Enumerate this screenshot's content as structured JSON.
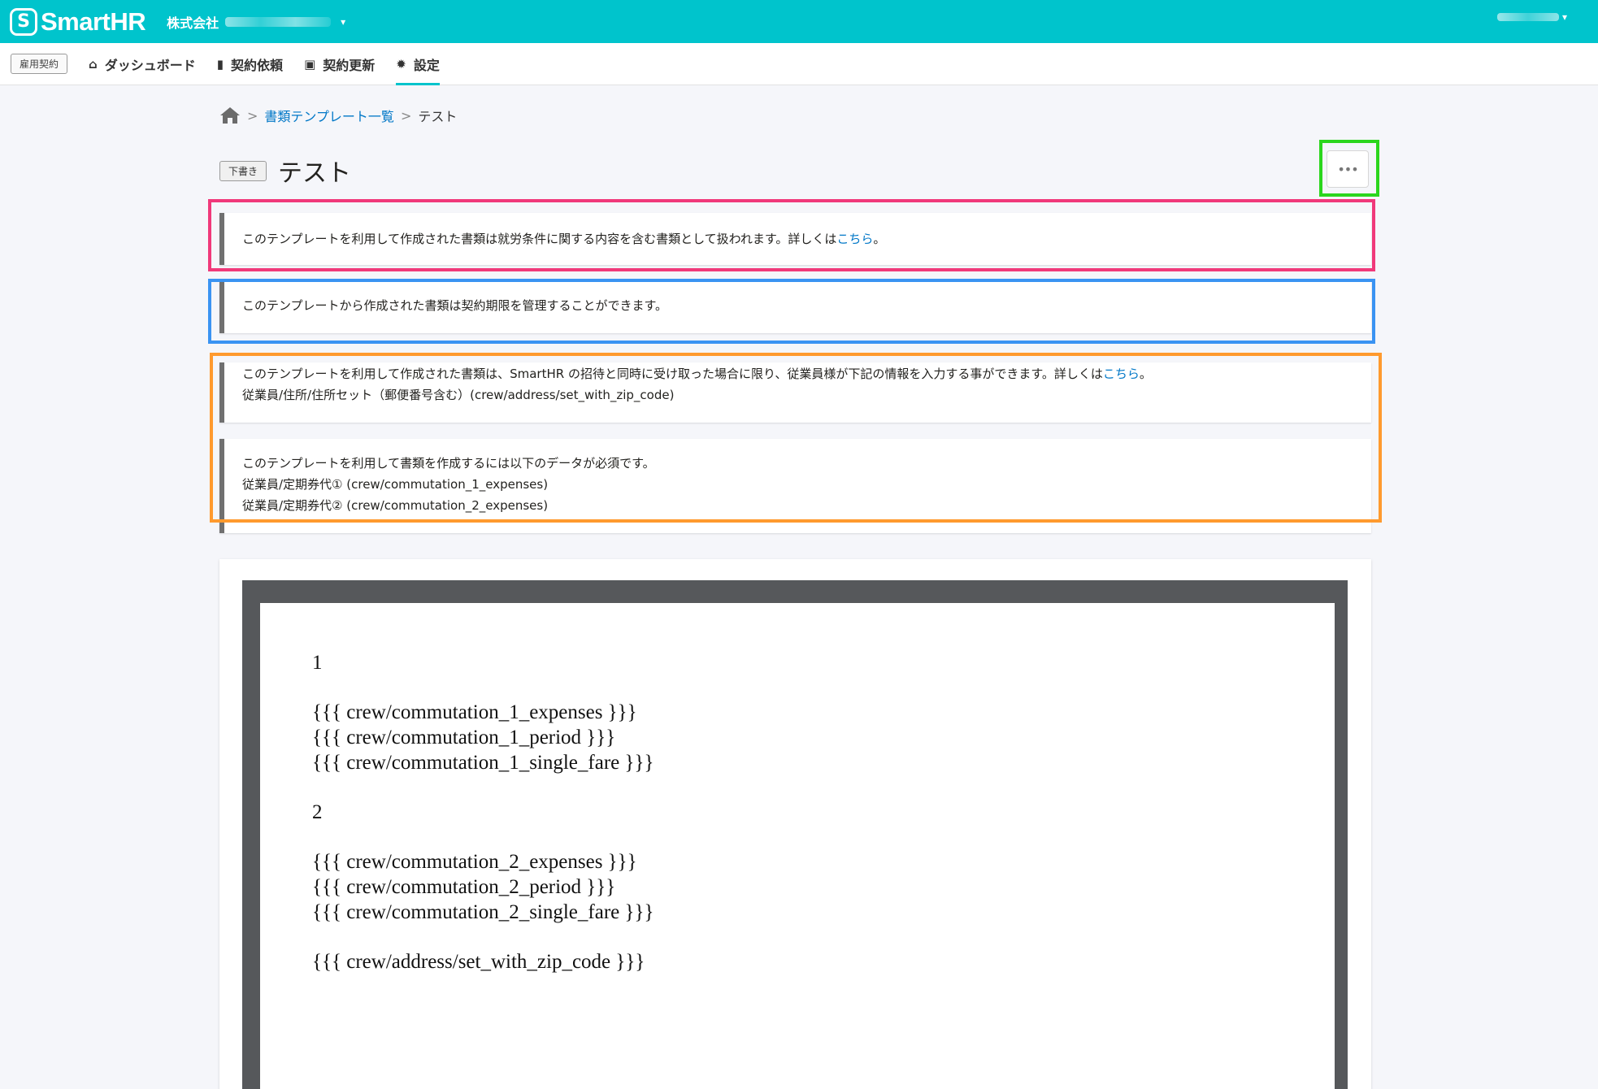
{
  "header": {
    "logo_text": "SmartHR",
    "logo_mark": "S",
    "company_label": "株式会社",
    "caret": "▾"
  },
  "nav": {
    "app_badge": "雇用契約",
    "items": [
      {
        "label": "ダッシュボード",
        "icon": "home-icon",
        "glyph": "⌂"
      },
      {
        "label": "契約依頼",
        "icon": "document-icon",
        "glyph": "▮"
      },
      {
        "label": "契約更新",
        "icon": "calendar-check-icon",
        "glyph": "▣"
      },
      {
        "label": "設定",
        "icon": "gear-icon",
        "glyph": "✹"
      }
    ],
    "active_index": 3
  },
  "breadcrumb": {
    "separator": ">",
    "link": "書類テンプレート一覧",
    "current": "テスト"
  },
  "title": {
    "badge": "下書き",
    "text": "テスト",
    "more_label": "•••"
  },
  "info": {
    "notice1_text": "このテンプレートを利用して作成された書類は就労条件に関する内容を含む書類として扱われます。詳しくは",
    "notice1_link": "こちら",
    "notice1_tail": "。",
    "notice2_text": "このテンプレートから作成された書類は契約期限を管理することができます。",
    "notice3_text": "このテンプレートを利用して作成された書類は、SmartHR の招待と同時に受け取った場合に限り、従業員様が下記の情報を入力する事ができます。詳しくは",
    "notice3_link": "こちら",
    "notice3_tail": "。",
    "notice3_item": "従業員/住所/住所セット（郵便番号含む）(crew/address/set_with_zip_code)",
    "notice4_text": "このテンプレートを利用して書類を作成するには以下のデータが必須です。",
    "notice4_items": [
      "従業員/定期券代① (crew/commutation_1_expenses)",
      "従業員/定期券代② (crew/commutation_2_expenses)"
    ]
  },
  "document": {
    "lines": [
      "1",
      "",
      "{{{ crew/commutation_1_expenses }}}",
      "{{{ crew/commutation_1_period }}}",
      "{{{ crew/commutation_1_single_fare }}}",
      "",
      "2",
      "",
      "{{{ crew/commutation_2_expenses }}}",
      "{{{ crew/commutation_2_period }}}",
      "{{{ crew/commutation_2_single_fare }}}",
      "",
      "{{{ crew/address/set_with_zip_code }}}"
    ]
  },
  "highlight_colors": {
    "green": "#2bd61d",
    "red": "#f0397a",
    "blue": "#3a93f2",
    "orange": "#ff9a2e"
  },
  "brand_color": "#00c4cc"
}
